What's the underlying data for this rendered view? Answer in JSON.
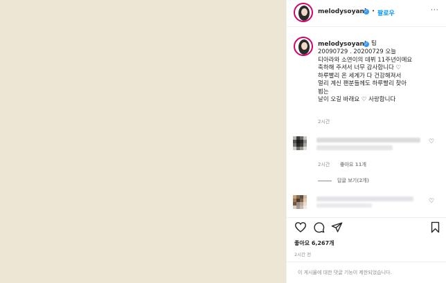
{
  "header": {
    "username": "melodysoyani",
    "follow_label": "팔로우",
    "separator": "•",
    "more": "···"
  },
  "post": {
    "username": "melodysoyani",
    "edited_tag": "팀",
    "caption_lines": [
      "20090729 . 20200729 오늘",
      "티아라와 소연이의 데뷔 11주년이에요",
      "축하해 주셔서 너무 감사합니다 ♡",
      "하루빨리 온 세계가 다 건강해져서",
      "멀리 계신 팬분들께도 하루빨리 찾아",
      "뵙는",
      "날이 오길 바래요 ♡ 사랑합니다"
    ],
    "time": "2시간"
  },
  "comments": {
    "comment1_meta_time": "2시간",
    "comment1_likes": "좋아요 11개",
    "view_replies": "답글 보기(2개)"
  },
  "actions": {
    "likes": "좋아요 6,267개",
    "timestamp": "2시간 전",
    "comments_disabled": "이 게시물에 대한 댓글 기능이 제한되었습니다."
  },
  "colors": {
    "photo_bg": "#ebe7d4",
    "accent": "#0095f6",
    "verified": "#3897f0",
    "muted": "#8e8e8e"
  }
}
